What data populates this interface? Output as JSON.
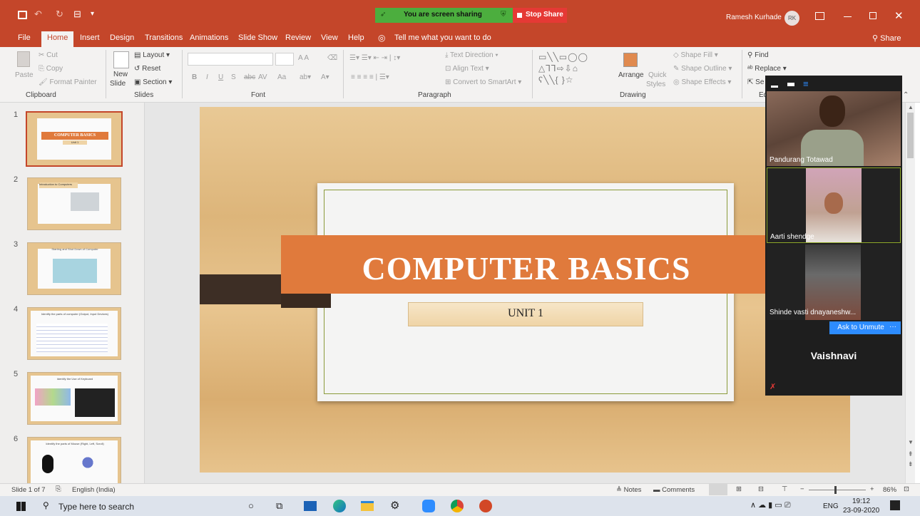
{
  "app": {
    "quick_access": "▾",
    "user_name": "Ramesh Kurhade",
    "user_initials": "RK",
    "share_label": "Share",
    "share_banner": "You are screen sharing",
    "stop_share": "Stop Share"
  },
  "tabs": [
    "File",
    "Home",
    "Insert",
    "Design",
    "Transitions",
    "Animations",
    "Slide Show",
    "Review",
    "View",
    "Help"
  ],
  "tell_me": "Tell me what you want to do",
  "ribbon": {
    "clipboard": {
      "paste": "Paste",
      "cut": "Cut",
      "copy": "Copy",
      "format_painter": "Format Painter",
      "group": "Clipboard"
    },
    "slides": {
      "new_slide_1": "New",
      "new_slide_2": "Slide",
      "layout": "Layout",
      "reset": "Reset",
      "section": "Section",
      "group": "Slides"
    },
    "font": {
      "bold": "B",
      "italic": "I",
      "underline": "U",
      "shadow": "S",
      "strike": "abc",
      "spacing": "AV",
      "case": "Aa",
      "group": "Font"
    },
    "paragraph": {
      "text_direction": "Text Direction",
      "align_text": "Align Text",
      "smartart": "Convert to SmartArt",
      "group": "Paragraph"
    },
    "drawing": {
      "arrange": "Arrange",
      "quick_styles_1": "Quick",
      "quick_styles_2": "Styles",
      "shape_fill": "Shape Fill",
      "shape_outline": "Shape Outline",
      "shape_effects": "Shape Effects",
      "group": "Drawing"
    },
    "editing": {
      "find": "Find",
      "replace": "Replace",
      "select": "Se",
      "group": "Ed"
    }
  },
  "thumbnails": [
    {
      "num": "1",
      "title": "COMPUTER BASICS",
      "sub": "Unit 1"
    },
    {
      "num": "2",
      "title": "Introduction to Computers"
    },
    {
      "num": "3",
      "title": "Starting and Shut Down of Computer"
    },
    {
      "num": "4",
      "title": "Identify the parts of computer (Output, Input Devices)"
    },
    {
      "num": "5",
      "title": "Identify the Use of Keyboard"
    },
    {
      "num": "6",
      "title": "Identify the parts of Mouse (Right, Left, Scroll)"
    }
  ],
  "slide": {
    "title": "COMPUTER BASICS",
    "subtitle": "UNIT 1"
  },
  "participants": [
    {
      "name": "Pandurang Totawad"
    },
    {
      "name": "Aarti shendge"
    },
    {
      "name": "Shinde vasti dnayaneshw..."
    }
  ],
  "zoom": {
    "ask_unmute": "Ask to Unmute",
    "more": "···",
    "current": "Vaishnavi"
  },
  "status": {
    "slide": "Slide 1 of 7",
    "language": "English (India)",
    "notes": "Notes",
    "comments": "Comments",
    "zoom_level": "86%"
  },
  "taskbar": {
    "search_placeholder": "Type here to search",
    "lang": "ENG",
    "time": "19:12",
    "date": "23-09-2020"
  }
}
